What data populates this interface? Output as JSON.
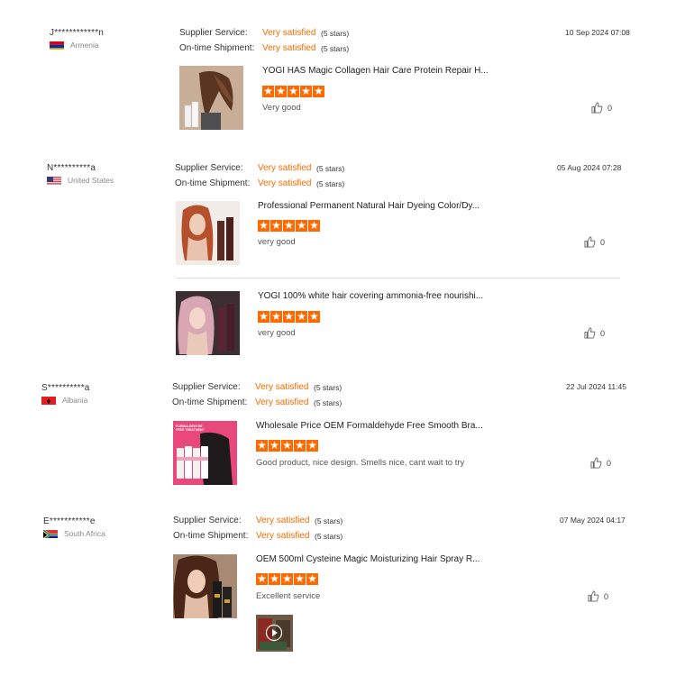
{
  "labels": {
    "supplier_service": "Supplier Service:",
    "ontime_shipment": "On-time Shipment:"
  },
  "reviews": [
    {
      "user": "J************n",
      "country": "Armenia",
      "date": "10 Sep 2024 07:08",
      "supplier_value": "Very satisfied",
      "supplier_stars": "(5 stars)",
      "shipment_value": "Very satisfied",
      "shipment_stars": "(5 stars)",
      "products": [
        {
          "title": "YOGI HAS Magic Collagen Hair Care Protein Repair H...",
          "rating": 5,
          "comment": "Very good",
          "likes": "0"
        }
      ]
    },
    {
      "user": "N**********a",
      "country": "United States",
      "date": "05 Aug 2024 07:28",
      "supplier_value": "Very satisfied",
      "supplier_stars": "(5 stars)",
      "shipment_value": "Very satisfied",
      "shipment_stars": "(5 stars)",
      "products": [
        {
          "title": "Professional Permanent Natural Hair Dyeing Color/Dy...",
          "rating": 5,
          "comment": "very good",
          "likes": "0"
        },
        {
          "title": "YOGI 100% white hair covering ammonia-free nourishi...",
          "rating": 5,
          "comment": "very good",
          "likes": "0"
        }
      ]
    },
    {
      "user": "S**********a",
      "country": "Albania",
      "date": "22 Jul 2024 11:45",
      "supplier_value": "Very satisfied",
      "supplier_stars": "(5 stars)",
      "shipment_value": "Very satisfied",
      "shipment_stars": "(5 stars)",
      "products": [
        {
          "title": "Wholesale Price OEM Formaldehyde Free Smooth Bra...",
          "rating": 5,
          "comment": "Good product, nice design. Smells nice, cant wait to try",
          "likes": "0",
          "thumb_caption": "FORMALDEHYDE FREE TREATMENT"
        }
      ]
    },
    {
      "user": "E***********e",
      "country": "South Africa",
      "date": "07 May 2024 04:17",
      "supplier_value": "Very satisfied",
      "supplier_stars": "(5 stars)",
      "shipment_value": "Very satisfied",
      "shipment_stars": "(5 stars)",
      "products": [
        {
          "title": "OEM 500ml Cysteine Magic Moisturizing Hair Spray R...",
          "rating": 5,
          "comment": "Excellent service",
          "likes": "0"
        }
      ]
    }
  ],
  "colors": {
    "accent": "#ff6a00",
    "text": "#333333",
    "muted": "#888888",
    "divider": "#dddddd"
  },
  "icons": {
    "like": "thumbs-up-icon",
    "video_play": "play-icon",
    "star": "star-icon"
  }
}
